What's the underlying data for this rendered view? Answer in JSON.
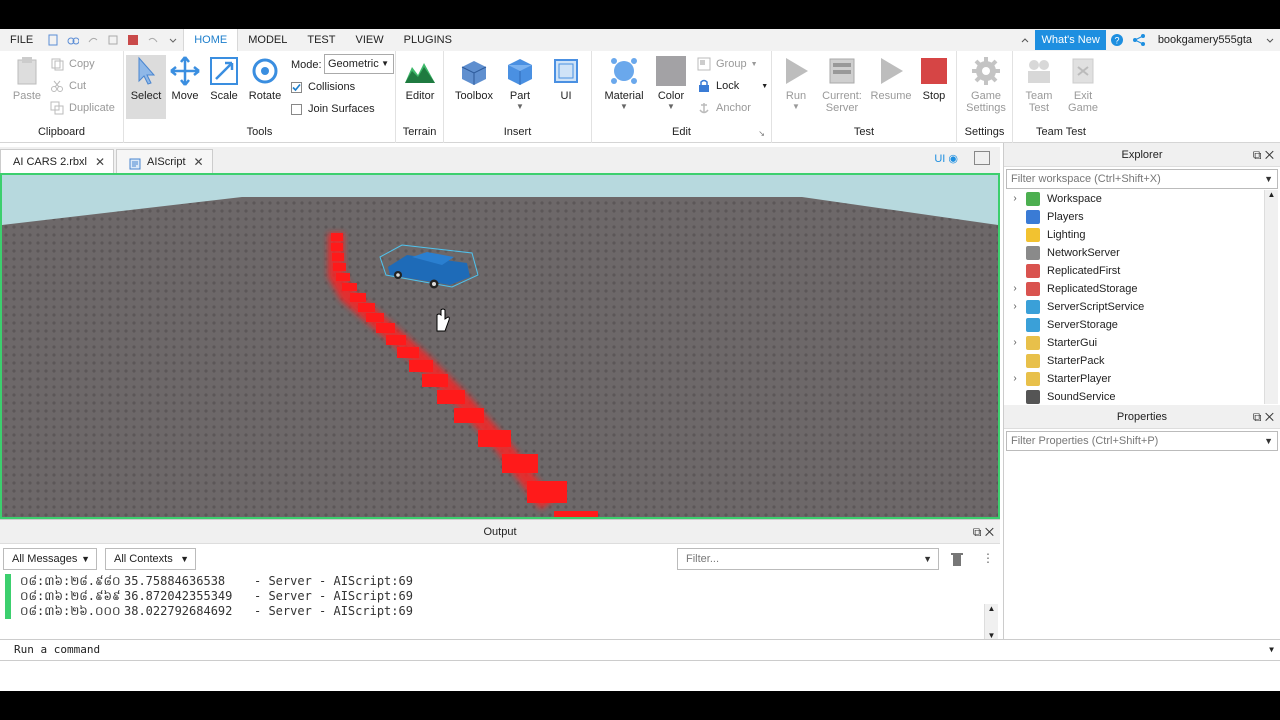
{
  "menubar": {
    "file": "FILE",
    "tabs": [
      "HOME",
      "MODEL",
      "TEST",
      "VIEW",
      "PLUGINS"
    ],
    "whats_new": "What's New",
    "username": "bookgamery555gta"
  },
  "ribbon": {
    "clipboard": {
      "label": "Clipboard",
      "paste": "Paste",
      "copy": "Copy",
      "cut": "Cut",
      "duplicate": "Duplicate"
    },
    "tools": {
      "label": "Tools",
      "select": "Select",
      "move": "Move",
      "scale": "Scale",
      "rotate": "Rotate",
      "mode_label": "Mode:",
      "mode_value": "Geometric",
      "collisions": "Collisions",
      "join_surfaces": "Join Surfaces"
    },
    "terrain": {
      "label": "Terrain",
      "editor": "Editor"
    },
    "insert": {
      "label": "Insert",
      "toolbox": "Toolbox",
      "part": "Part",
      "ui": "UI"
    },
    "edit": {
      "label": "Edit",
      "material": "Material",
      "color": "Color",
      "group": "Group",
      "lock": "Lock",
      "anchor": "Anchor"
    },
    "test": {
      "label": "Test",
      "run": "Run",
      "current_line1": "Current:",
      "current_line2": "Server",
      "resume": "Resume",
      "stop": "Stop"
    },
    "settings": {
      "label": "Settings",
      "game_line1": "Game",
      "game_line2": "Settings"
    },
    "team_test": {
      "label": "Team Test",
      "team_line1": "Team",
      "team_line2": "Test",
      "exit_line1": "Exit",
      "exit_line2": "Game"
    }
  },
  "doc_tabs": [
    {
      "label": "AI CARS 2.rbxl"
    },
    {
      "label": "AIScript"
    }
  ],
  "viewport": {
    "ui_toggle": "UI"
  },
  "output": {
    "title": "Output",
    "messages_filter": "All Messages",
    "contexts_filter": "All Contexts",
    "filter_placeholder": "Filter...",
    "lines": [
      {
        "time": "០៨:៣៦:២៨.៩៨០",
        "value": "35.75884636538",
        "source": "-  Server - AIScript:69"
      },
      {
        "time": "០៨:៣៦:២៨.៩៦៩",
        "value": "36.872042355349",
        "source": "-  Server - AIScript:69"
      },
      {
        "time": "០៨:៣៦:២៦.០០០",
        "value": "38.022792684692",
        "source": "-  Server - AIScript:69"
      }
    ]
  },
  "command_bar": {
    "placeholder": "Run a command"
  },
  "explorer": {
    "title": "Explorer",
    "filter_placeholder": "Filter workspace (Ctrl+Shift+X)",
    "items": [
      {
        "label": "Workspace",
        "expandable": true,
        "icon_color": "#4caf50"
      },
      {
        "label": "Players",
        "expandable": false,
        "icon_color": "#3a7bd5"
      },
      {
        "label": "Lighting",
        "expandable": false,
        "icon_color": "#f2c230"
      },
      {
        "label": "NetworkServer",
        "expandable": false,
        "icon_color": "#8a8a8a"
      },
      {
        "label": "ReplicatedFirst",
        "expandable": false,
        "icon_color": "#d9534f"
      },
      {
        "label": "ReplicatedStorage",
        "expandable": true,
        "icon_color": "#d9534f"
      },
      {
        "label": "ServerScriptService",
        "expandable": true,
        "icon_color": "#3aa0d8"
      },
      {
        "label": "ServerStorage",
        "expandable": false,
        "icon_color": "#3aa0d8"
      },
      {
        "label": "StarterGui",
        "expandable": true,
        "icon_color": "#e8c04a"
      },
      {
        "label": "StarterPack",
        "expandable": false,
        "icon_color": "#e8c04a"
      },
      {
        "label": "StarterPlayer",
        "expandable": true,
        "icon_color": "#e8c04a"
      },
      {
        "label": "SoundService",
        "expandable": false,
        "icon_color": "#555555"
      }
    ]
  },
  "properties": {
    "title": "Properties",
    "filter_placeholder": "Filter Properties (Ctrl+Shift+P)"
  },
  "colors": {
    "accent": "#1e8fe0",
    "viewport_border": "#3ccf6e",
    "trail": "#ff1a1a",
    "car": "#1e6bb8"
  }
}
